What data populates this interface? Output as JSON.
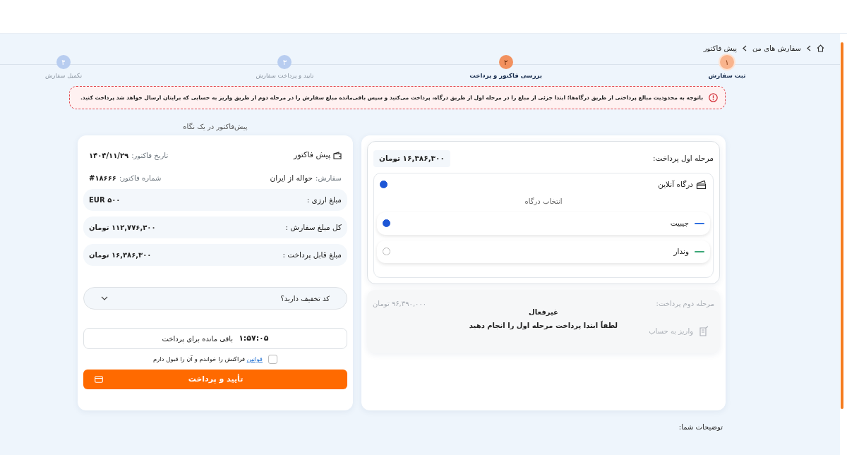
{
  "breadcrumb": [
    {
      "label": "سفارش های من"
    },
    {
      "label": "پیش فاکتور"
    }
  ],
  "steps": [
    {
      "number": "۱",
      "label": "ثبت سفارش",
      "completed": true,
      "selected": false
    },
    {
      "number": "۲",
      "label": "بررسی فاکتور و پرداخت",
      "completed": false,
      "selected": true
    },
    {
      "number": "۳",
      "label": "تایید و پرداخت سفارش",
      "completed": false,
      "selected": false
    },
    {
      "number": "۴",
      "label": "تکمیل سفارش",
      "completed": false,
      "selected": false
    }
  ],
  "alert": {
    "text": "باتوجه به محدودیت مبالغ پرداختی از طریق درگاه‌ها؛ ابتدا جزئی از مبلغ را در مرحله اول از طریق درگاه، پرداخت می‌کنید و سپس باقی‌مانده مبلغ سفارش را در مرحله دوم از طریق واریز به حسابی که برایتان ارسال خواهد شد پرداخت کنید."
  },
  "stage_one": {
    "title": "مرحله اول پرداخت:",
    "amount": "۱۶,۳۸۶,۳۰۰ تومان",
    "method": {
      "label": "درگاه آنلاین",
      "selected": true,
      "hint": "انتخاب درگاه",
      "gateways": [
        {
          "name": "جیبیت",
          "color": "#2f6fe0",
          "selected": true
        },
        {
          "name": "وندار",
          "color": "#3aa676",
          "selected": false
        }
      ]
    }
  },
  "stage_two": {
    "title": "مرحله دوم پرداخت:",
    "amount": "۹۶,۳۹۰,۰۰۰ تومان",
    "method": "واریز به حساب",
    "disabled": true,
    "status": "غیرفعال",
    "message": "لطفاً ابتدا پرداخت مرحله اول را انجام دهید"
  },
  "invoice": {
    "heading": "پیش‌فاکتور در یک نگاه",
    "title": "پیش فاکتور",
    "date_label": "تاریخ فاکتور:",
    "date": "۱۴۰۴/۱۱/۲۹",
    "order_label": "سفارش:",
    "order": "حواله از ایران",
    "number_label": "شماره فاکتور:",
    "number": "#۱۸۶۶۶",
    "amounts": [
      {
        "label": "مبلغ ارزی :",
        "value": "EUR ۵۰۰"
      },
      {
        "label": "کل مبلغ سفارش :",
        "value": "۱۱۲,۷۷۶,۳۰۰ تومان"
      },
      {
        "label": "مبلغ قابل پرداخت :",
        "value": "۱۶,۳۸۶,۳۰۰ تومان"
      }
    ],
    "discount": {
      "label": "کد تخفیف دارید؟",
      "expanded": false
    },
    "timer": {
      "time": "۱:۵۷:۰۵",
      "label": "باقی مانده برای پرداخت"
    },
    "terms": {
      "checked": false,
      "link": "قوانین",
      "text": "فراکنش را خواندم و آن را قبول دارم"
    },
    "submit": "تأیید و پرداخت"
  },
  "notes_label": "توضیحات شما:"
}
